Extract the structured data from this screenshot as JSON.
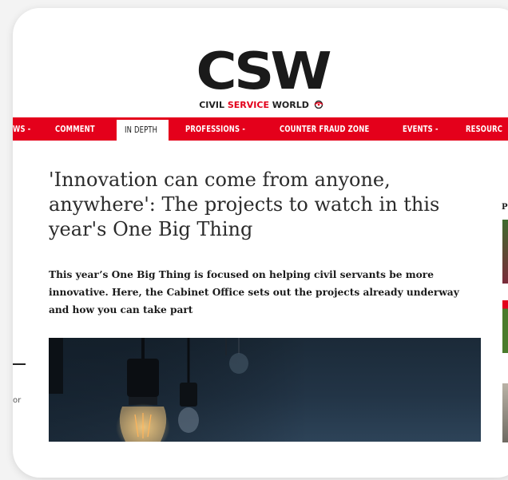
{
  "site": {
    "logo_text": "CSW",
    "logo_sub": [
      "CIVIL ",
      "SERVICE",
      " WORLD"
    ],
    "brand_red": "#e4001b"
  },
  "nav": {
    "items": [
      {
        "label": "WS -"
      },
      {
        "label": "COMMENT"
      },
      {
        "label": "IN DEPTH",
        "active": true
      },
      {
        "label": "PROFESSIONS -"
      },
      {
        "label": "COUNTER FRAUD ZONE"
      },
      {
        "label": "EVENTS -"
      },
      {
        "label": "RESOURC"
      }
    ]
  },
  "article": {
    "headline": "'Innovation can come from anyone, anywhere': The projects to watch in this year's One Big Thing",
    "standfirst": "This year’s One Big Thing is focused on helping civil servants be more innovative. Here, the Cabinet Office sets out the projects already underway and how you can take part"
  },
  "edges": {
    "left_fragment": "or",
    "right_fragment": "P"
  }
}
